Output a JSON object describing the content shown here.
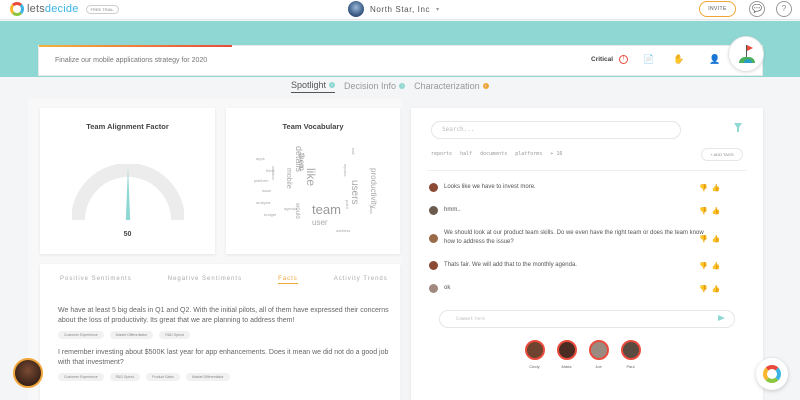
{
  "topbar": {
    "logo_text_a": "lets",
    "logo_text_b": "decide",
    "trial_badge": "FREE TRIAL",
    "org_name": "North Star, Inc",
    "org_caret": "▾",
    "invite_label": "INVITE",
    "chat_icon_glyph": "💬",
    "help_icon_glyph": "?"
  },
  "decision": {
    "title": "Finalize our mobile applications strategy for 2020",
    "priority_label": "Critical",
    "priority_icon": "!",
    "tools": [
      "📄",
      "✋",
      "👤",
      "🖥"
    ]
  },
  "tabs": [
    {
      "label": "Spotlight",
      "active": true
    },
    {
      "label": "Decision Info",
      "active": false
    },
    {
      "label": "Characterization",
      "active": false
    }
  ],
  "alignment": {
    "title": "Team Alignment Factor",
    "value": "50",
    "fraction": 0.5
  },
  "vocabulary": {
    "title": "Team Vocabulary",
    "words": [
      "details",
      "like",
      "them",
      "mobile",
      "would",
      "team",
      "users",
      "productivity",
      "user",
      "apps",
      "platform",
      "issue",
      "analysis",
      "solution",
      "budget",
      "agenda",
      "reports",
      "half",
      "data",
      "think",
      "point",
      "address"
    ]
  },
  "sentiments": {
    "tabs": [
      "Positive Sentiments",
      "Negative Sentiments",
      "Facts",
      "Activity Trends"
    ],
    "active_tab": 2,
    "facts": [
      {
        "text": "We have at least 5 big deals in Q1 and Q2. With the initial pilots, all of them have expressed their concerns about the loss of productivity. Its great that we are planning to address them!",
        "tags": [
          "Customer Experience",
          "Market Differentiator",
          "R&D Spend"
        ]
      },
      {
        "text": "I remember investing about $500K last year for app enhancements. Does it mean we did not do a good job with that investment?",
        "tags": [
          "Customer Experience",
          "R&D Spend",
          "Product Sales",
          "Market Differentiator"
        ]
      }
    ]
  },
  "chat": {
    "search_placeholder": "Search...",
    "tags": [
      "reports",
      "half",
      "documents",
      "platforms",
      "+ 16"
    ],
    "add_tags_label": "+ ADD TAGS",
    "messages": [
      {
        "text": "Looks like we have to invest more.",
        "avatar_color": "#8a4a33"
      },
      {
        "text": "hmm..",
        "avatar_color": "#6b5a4e"
      },
      {
        "text": "We should look at our product team skills. Do we even have the right team or does the team know how to address the issue?",
        "avatar_color": "#9a6a4a"
      },
      {
        "text": "Thats fair. We will add that to the monthly agenda.",
        "avatar_color": "#8a4a33"
      },
      {
        "text": "ok",
        "avatar_color": "#a08a80"
      }
    ],
    "comment_placeholder": "Comment here",
    "participants": [
      {
        "name": "Cindy",
        "color": "#6e4330"
      },
      {
        "name": "Maria",
        "color": "#4a2c22"
      },
      {
        "name": "Joe",
        "color": "#9b8a80"
      },
      {
        "name": "Paul",
        "color": "#5a4a40"
      }
    ]
  }
}
